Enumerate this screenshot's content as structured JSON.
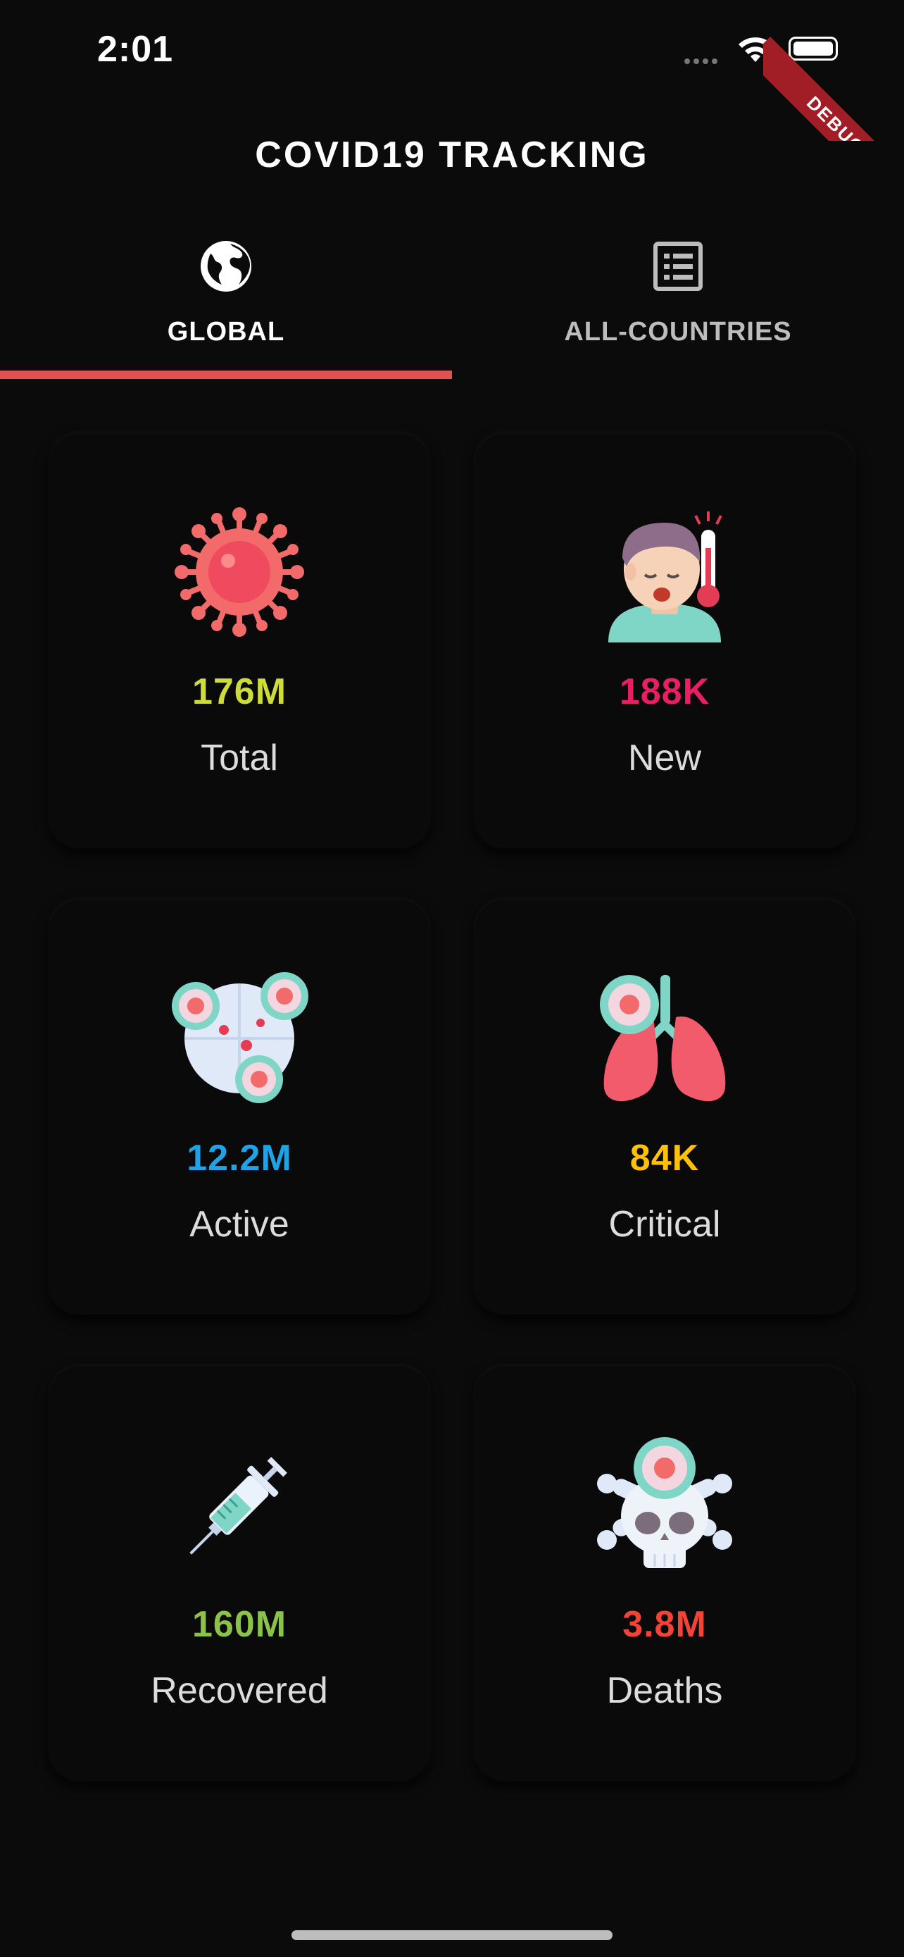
{
  "status_bar": {
    "time": "2:01",
    "debug_banner": "DEBUG"
  },
  "app": {
    "title": "COVID19 TRACKING"
  },
  "tabs": [
    {
      "label": "GLOBAL",
      "icon": "globe-icon",
      "active": true
    },
    {
      "label": "ALL-COUNTRIES",
      "icon": "list-icon",
      "active": false
    }
  ],
  "stats": [
    {
      "value": "176M",
      "label": "Total",
      "value_color": "#cddc39",
      "icon": "virus-icon"
    },
    {
      "value": "188K",
      "label": "New",
      "value_color": "#e91e63",
      "icon": "sick-person-icon"
    },
    {
      "value": "12.2M",
      "label": "Active",
      "value_color": "#1ea3e8",
      "icon": "virus-spread-icon"
    },
    {
      "value": "84K",
      "label": "Critical",
      "value_color": "#ffc107",
      "icon": "lungs-icon"
    },
    {
      "value": "160M",
      "label": "Recovered",
      "value_color": "#8bc34a",
      "icon": "vaccine-syringe-icon"
    },
    {
      "value": "3.8M",
      "label": "Deaths",
      "value_color": "#f44336",
      "icon": "skull-icon"
    }
  ],
  "colors": {
    "accent": "#e05252",
    "background": "#0b0b0b"
  }
}
